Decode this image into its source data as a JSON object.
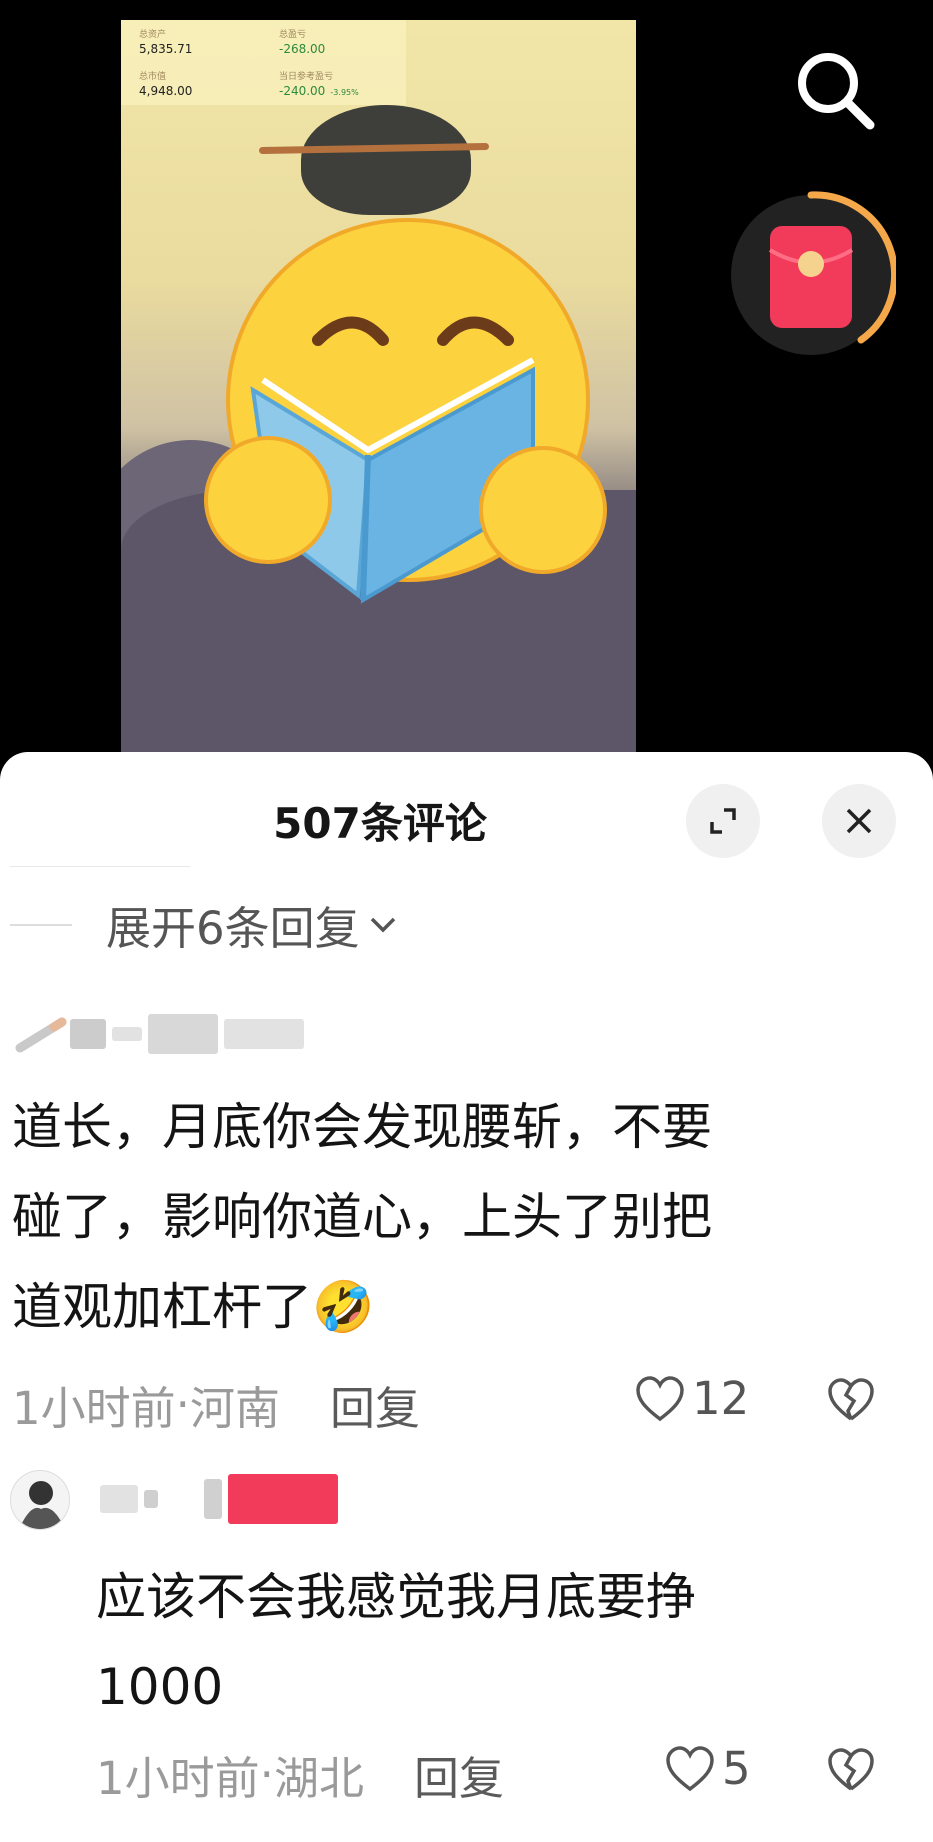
{
  "ticker": {
    "total_assets_label": "总资产",
    "total_assets": "5,835.71",
    "total_pnl_label": "总盈亏",
    "total_pnl": "-268.00",
    "market_value_label": "总市值",
    "market_value": "4,948.00",
    "daily_pnl_label": "当日参考盈亏",
    "daily_pnl": "-240.00",
    "daily_pct": "-3.95%"
  },
  "icons": {
    "search": "search-icon",
    "red_envelope": "red-envelope-icon",
    "expand": "expand-icon",
    "close": "close-icon",
    "heart": "heart-icon",
    "broken_heart": "broken-heart-icon"
  },
  "colors": {
    "accent_red": "#f23a5a",
    "envelope_ring": "#f4a84a"
  },
  "sheet": {
    "title": "507条评论"
  },
  "thread": {
    "expand_label": "展开6条回复"
  },
  "comments": [
    {
      "text_lines": [
        "道长，月底你会发现腰斩，不要",
        "碰了，影响你道心，上头了别把",
        "道观加杠杆了"
      ],
      "emoji": "🤣",
      "time": "1小时前",
      "location": "河南",
      "reply_label": "回复",
      "likes": "12"
    },
    {
      "text_lines": [
        "应该不会我感觉我月底要挣",
        "1000"
      ],
      "time": "1小时前",
      "location": "湖北",
      "reply_label": "回复",
      "likes": "5"
    }
  ],
  "separator": " · "
}
